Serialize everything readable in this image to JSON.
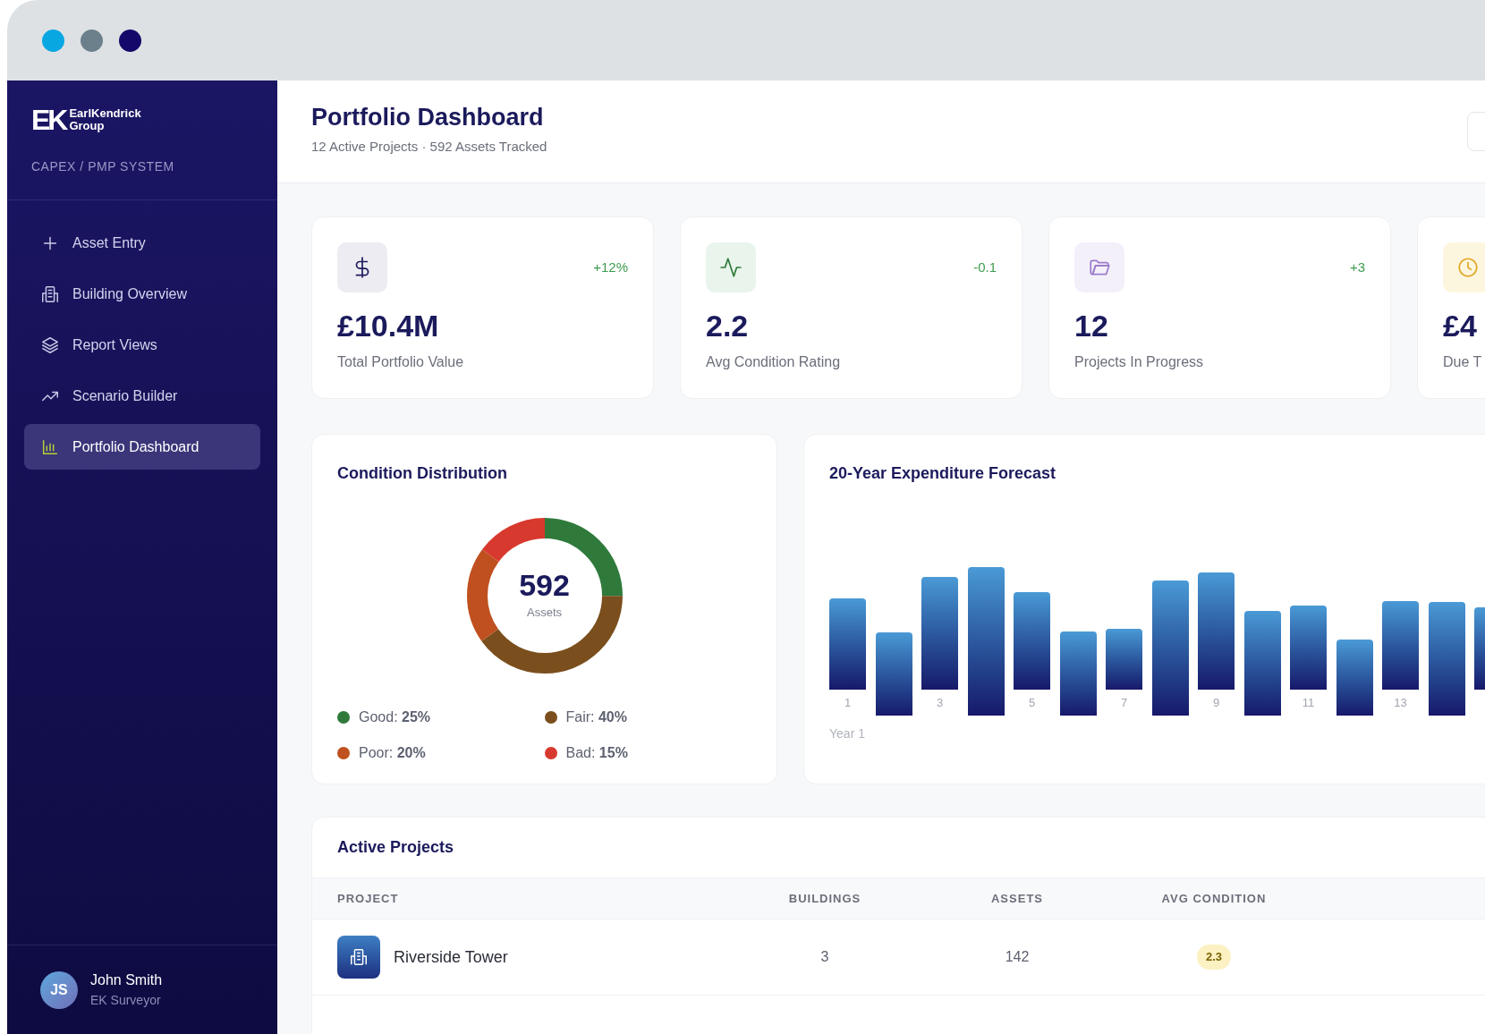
{
  "sidebar": {
    "logo": {
      "mark": "EK",
      "name_line1": "EarlKendrick",
      "name_line2": "Group"
    },
    "system": "CAPEX / PMP SYSTEM",
    "items": [
      {
        "label": "Asset Entry",
        "selected": false
      },
      {
        "label": "Building Overview",
        "selected": false
      },
      {
        "label": "Report Views",
        "selected": false
      },
      {
        "label": "Scenario Builder",
        "selected": false
      },
      {
        "label": "Portfolio Dashboard",
        "selected": true
      }
    ],
    "user": {
      "initials": "JS",
      "name": "John Smith",
      "role": "EK Surveyor"
    }
  },
  "header": {
    "title": "Portfolio Dashboard",
    "subtitle": "12 Active Projects · 592 Assets Tracked"
  },
  "stats": [
    {
      "value": "£10.4M",
      "label": "Total Portfolio Value",
      "delta": "+12%"
    },
    {
      "value": "2.2",
      "label": "Avg Condition Rating",
      "delta": "-0.1"
    },
    {
      "value": "12",
      "label": "Projects In Progress",
      "delta": "+3"
    },
    {
      "value": "£4",
      "label": "Due T"
    }
  ],
  "condition": {
    "title": "Condition Distribution",
    "center_value": "592",
    "center_label": "Assets",
    "legend": [
      {
        "text": "Good: **25%**",
        "color": "#2f7a3b"
      },
      {
        "text": "Fair: **40%**",
        "color": "#7a4f1d"
      },
      {
        "text": "Poor: **20%**",
        "color": "#c0501f"
      },
      {
        "text": "Bad: **15%**",
        "color": "#d8392e"
      }
    ]
  },
  "forecast": {
    "title": "20-Year Expenditure Forecast",
    "x_labels": [
      "1",
      "3",
      "5",
      "7",
      "9",
      "11",
      "13"
    ],
    "axis_label": "Year 1"
  },
  "projects": {
    "title": "Active Projects",
    "columns": [
      "PROJECT",
      "BUILDINGS",
      "ASSETS",
      "AVG CONDITION"
    ],
    "rows": [
      {
        "name": "Riverside Tower",
        "buildings": "3",
        "assets": "142",
        "avg_condition": "2.3"
      }
    ]
  }
}
